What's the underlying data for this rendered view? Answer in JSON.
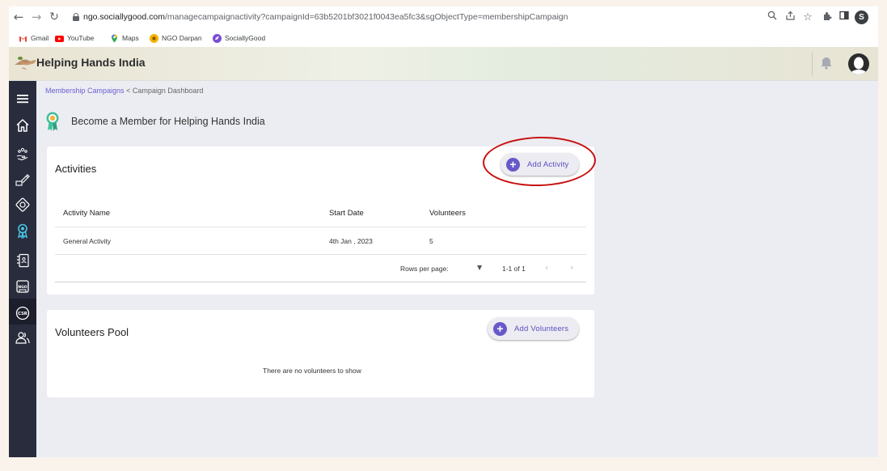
{
  "browser": {
    "url_host": "ngo.sociallygood.com",
    "url_path": "/managecampaignactivity?campaignId=63b5201bf3021f0043ea5fc3&sgObjectType=membershipCampaign",
    "profile_initial": "S",
    "bookmarks": [
      {
        "label": "Gmail",
        "icon": "gmail-icon",
        "color": "#ea4335"
      },
      {
        "label": "YouTube",
        "icon": "youtube-icon",
        "color": "#ff0000"
      },
      {
        "label": "Maps",
        "icon": "maps-icon",
        "color": "#34a853"
      },
      {
        "label": "NGO Darpan",
        "icon": "ngo-darpan-icon",
        "color": "#f4b400"
      },
      {
        "label": "SociallyGood",
        "icon": "sociallygood-icon",
        "color": "#7b4fd6"
      }
    ]
  },
  "header": {
    "brand": "Helping Hands India"
  },
  "sidebar": {
    "items": [
      {
        "icon": "menu-icon"
      },
      {
        "icon": "home-icon"
      },
      {
        "icon": "donation-icon"
      },
      {
        "icon": "fundraise-icon"
      },
      {
        "icon": "badge-icon"
      },
      {
        "icon": "membership-ribbon-icon",
        "active": true
      },
      {
        "icon": "list-icon"
      },
      {
        "icon": "ngo-icon"
      },
      {
        "icon": "csr-icon",
        "label": "CSR"
      },
      {
        "icon": "people-icon"
      }
    ]
  },
  "breadcrumb": {
    "link": "Membership Campaigns",
    "separator": "<",
    "current": "Campaign Dashboard"
  },
  "page": {
    "title": "Become a Member for Helping Hands India"
  },
  "activities": {
    "title": "Activities",
    "add_button": "Add Activity",
    "columns": [
      "Activity Name",
      "Start Date",
      "Volunteers"
    ],
    "rows": [
      {
        "name": "General Activity",
        "start_date": "4th Jan , 2023",
        "volunteers": "5"
      }
    ],
    "pagination": {
      "rows_per_page_label": "Rows per page:",
      "range": "1-1 of 1"
    }
  },
  "volunteers": {
    "title": "Volunteers Pool",
    "add_button": "Add Volunteers",
    "empty_message": "There are no volunteers to show"
  },
  "colors": {
    "accent": "#6859c9",
    "sidebar": "#292c3d",
    "annotation": "#c81010"
  }
}
